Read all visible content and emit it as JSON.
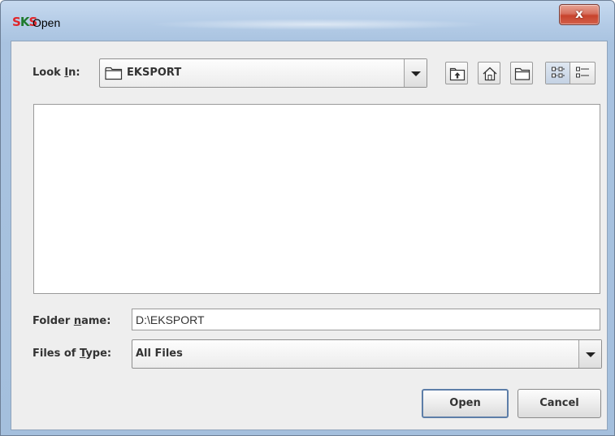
{
  "window": {
    "title": "Open",
    "logo": {
      "s1": "S",
      "k": "K",
      "s2": "S"
    },
    "close_label": "x"
  },
  "look_in": {
    "label_pre": "Look ",
    "label_mnemonic": "I",
    "label_post": "n:",
    "value": "EKSPORT"
  },
  "toolbar": {
    "icons": [
      "up-one-level-icon",
      "home-icon",
      "new-folder-icon",
      "list-view-icon",
      "details-view-icon"
    ]
  },
  "folder_name": {
    "label_pre": "Folder ",
    "label_mnemonic": "n",
    "label_post": "ame:",
    "value": "D:\\EKSPORT"
  },
  "files_of_type": {
    "label_pre": "Files of ",
    "label_mnemonic": "T",
    "label_post": "ype:",
    "value": "All Files"
  },
  "buttons": {
    "open": "Open",
    "cancel": "Cancel"
  }
}
